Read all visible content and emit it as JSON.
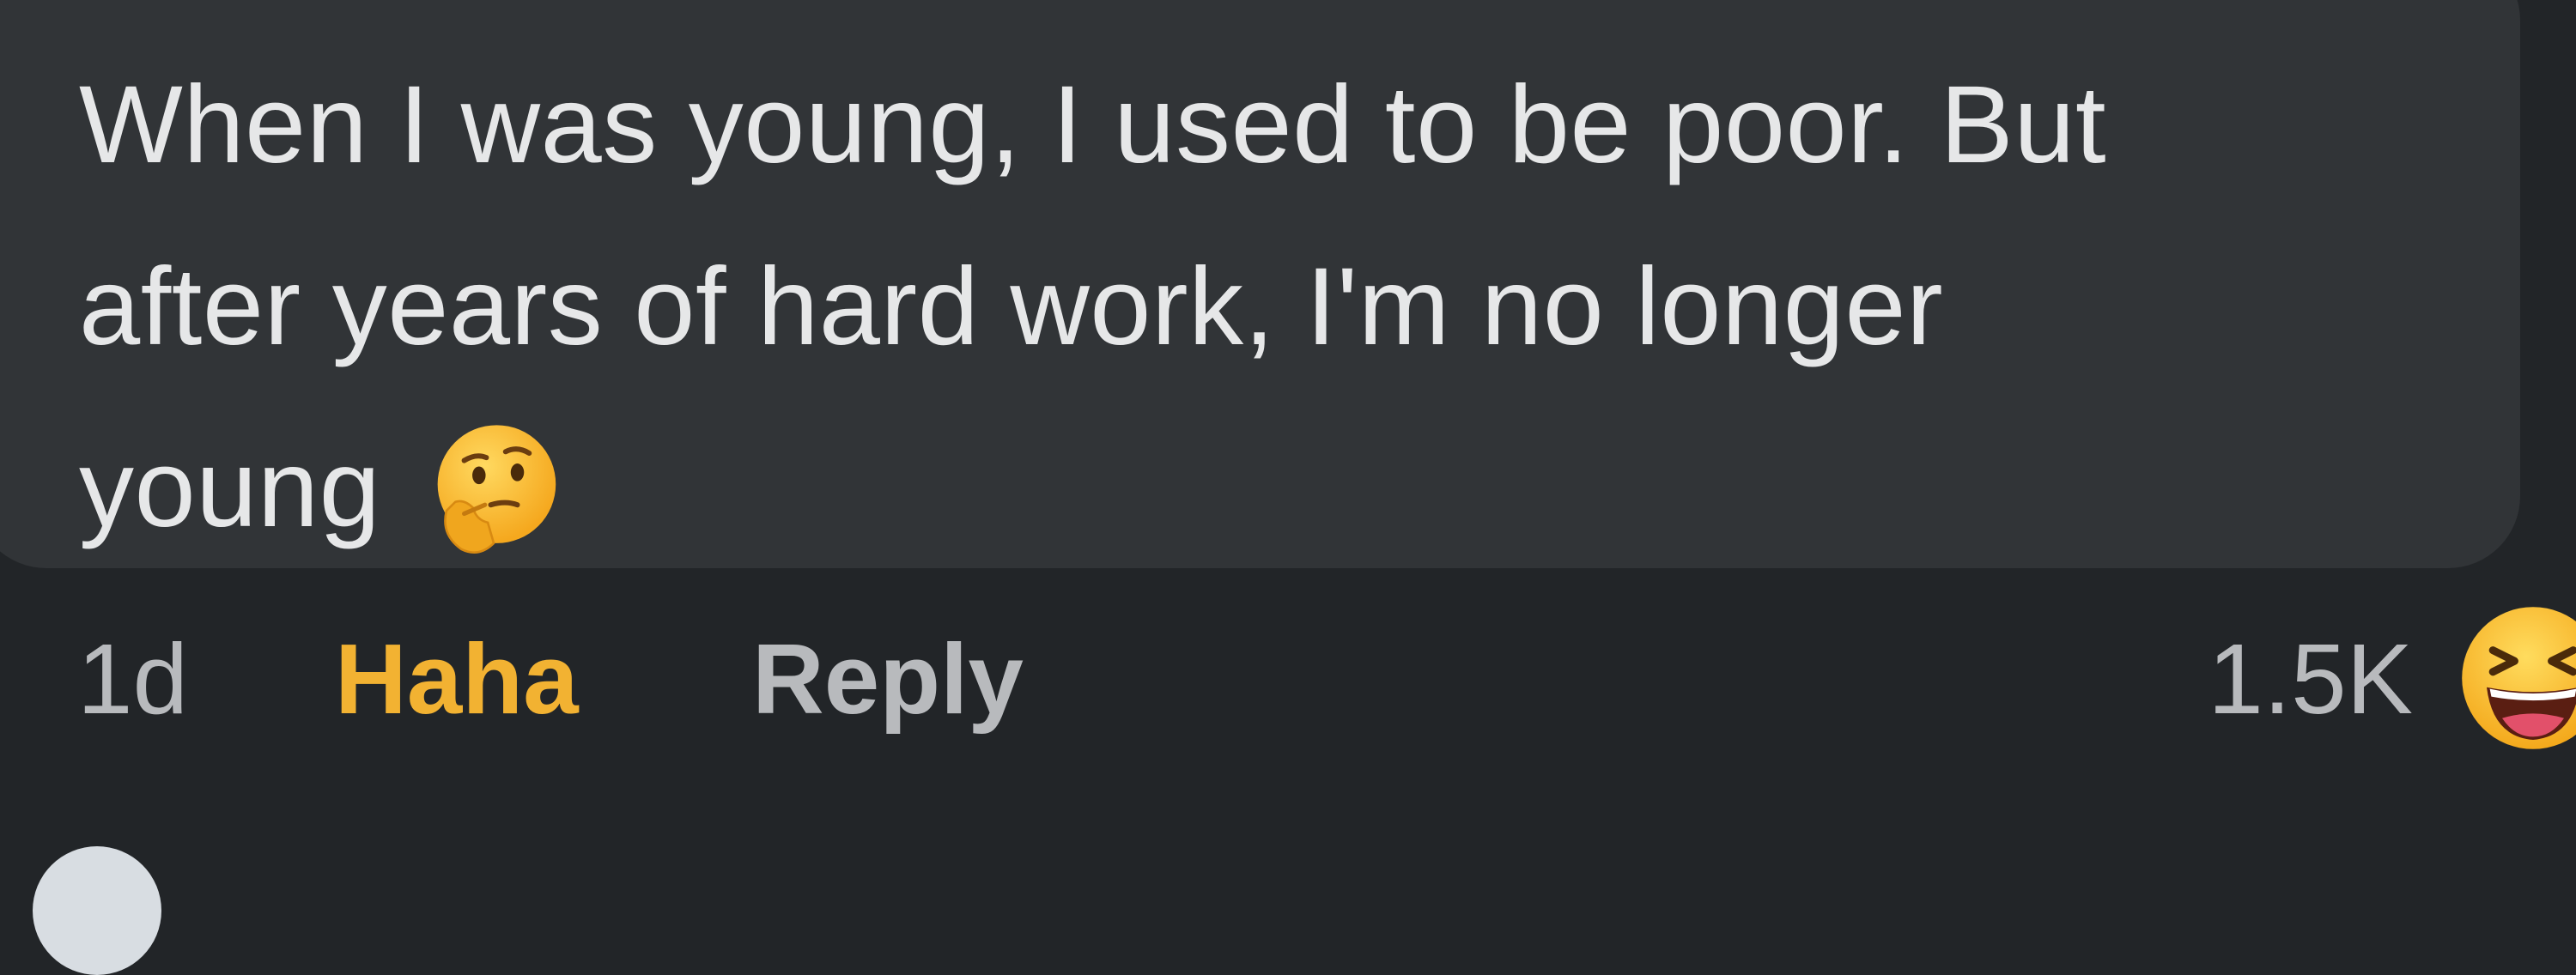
{
  "comment": {
    "lines": [
      "When I was young, I used to be poor. But",
      "after years of hard work, I'm no longer",
      "young"
    ],
    "trailing_emoji": "thinking-face-icon"
  },
  "actions": {
    "time": "1d",
    "reaction_label": "Haha",
    "reply_label": "Reply",
    "reaction_count": "1.5K",
    "reaction_icon": "laughing-face-icon"
  },
  "colors": {
    "background": "#222528",
    "bubble": "#313437",
    "text": "#e6e7e8",
    "muted": "#b8babd",
    "haha_active": "#f2b232"
  }
}
